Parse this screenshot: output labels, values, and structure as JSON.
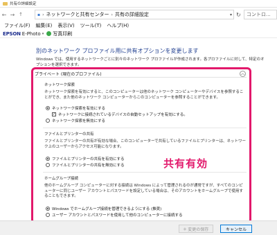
{
  "titlebar": {
    "title": "共有の詳細設定"
  },
  "address": {
    "breadcrumb": [
      "ネットワークと共有センター",
      "共有の詳細設定"
    ],
    "search_placeholder": "コントロ..."
  },
  "menu": [
    "ファイル(F)",
    "編集(E)",
    "表示(V)",
    "ツール(T)",
    "ヘルプ(H)"
  ],
  "epson": {
    "logo": "EPSON",
    "product": "E-Photo",
    "photo_print": "写真印刷"
  },
  "main": {
    "heading": "別のネットワーク プロファイル用に共有オプションを変更します",
    "intro": "Windows では、使用するネットワークごとに別々のネットワーク プロファイルが作成されます。各プロファイルに対して、特定のオプションを選択できます。",
    "private_section": {
      "title": "プライベート (現在のプロファイル)",
      "network_discovery": {
        "title": "ネットワーク探索",
        "description": "ネットワーク探索を有効にすると、このコンピューターは他のネットワーク コンピューターやデバイスを参照することができ、また他のネットワーク コンピューターからこのコンピューターを参照することができます。",
        "options": [
          "ネットワーク探索を有効にする",
          "ネットワークに接続されているデバイスの自動セットアップを有効にする。",
          "ネットワーク探索を無効にする"
        ]
      },
      "file_printer": {
        "title": "ファイルとプリンターの共有",
        "description": "ファイルとプリンターの共有が有効な場合、このコンピューターで共有しているファイルとプリンターは、ネットワーク上のユーザーからアクセス可能になります。",
        "options": [
          "ファイルとプリンターの共有を有効にする",
          "ファイルとプリンターの共有を無効にする"
        ]
      },
      "homegroup": {
        "title": "ホームグループ接続",
        "description": "他のホームグループ コンピューターに対する接続は Windows によって管理されるのが通常ですが、すべてのコンピューターに同じユーザー アカウントとパスワードを設定している場合は、そのアカウントをホームグループで使用することもできます。",
        "options": [
          "Windows でホームグループ接続を管理できるようにする (推奨)",
          "ユーザー アカウントとパスワードを使用して他のコンピューターに接続する"
        ]
      }
    }
  },
  "annotation": "共有有効",
  "footer": {
    "save": "変更の保存",
    "cancel": "キャンセル"
  }
}
